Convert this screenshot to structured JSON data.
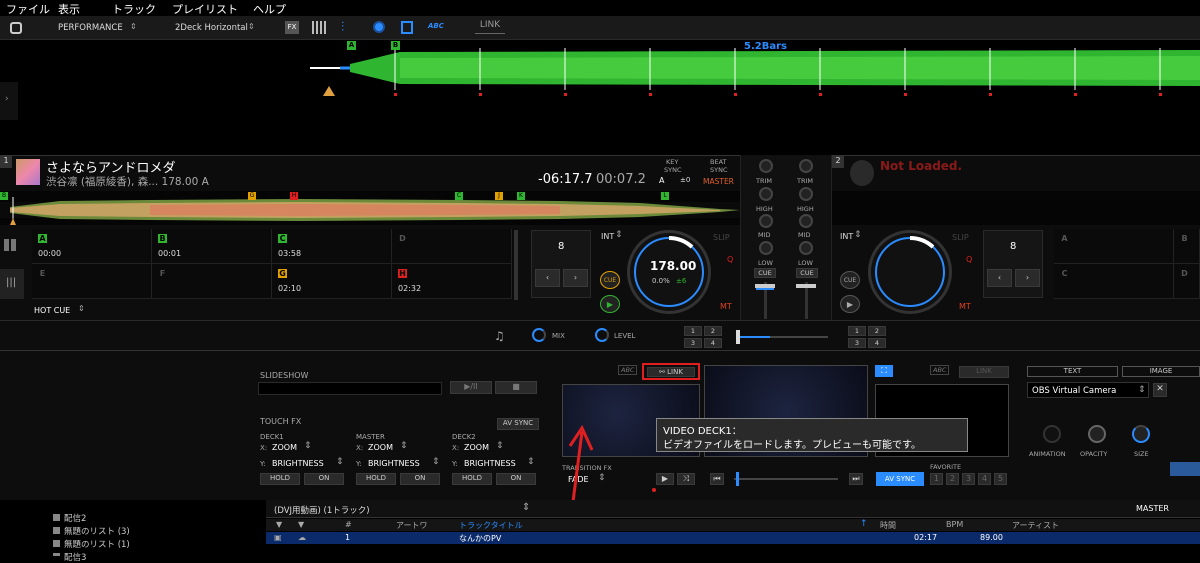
{
  "menu": [
    "ファイル",
    "表示",
    "トラック",
    "プレイリスト",
    "ヘルプ"
  ],
  "toolbar": {
    "mode": "PERFORMANCE",
    "layout": "2Deck Horizontal",
    "fx": "FX",
    "abc": "ABC",
    "link": "LINK"
  },
  "waveform": {
    "bars": "5.2Bars",
    "cue_a": "A",
    "cue_b": "B"
  },
  "deck1": {
    "num": "1",
    "title": "さよならアンドロメダ",
    "artist": "渋谷凛 (福原綾香), 森... 178.00 A",
    "remain": "-06:17.7",
    "elapsed": "00:07.2",
    "key_sync": "KEY\nSYNC",
    "key_label": "KEY",
    "sync_label": "SYNC",
    "key_val": "A",
    "key_off": "±0",
    "beat": "BEAT",
    "beat_sync": "SYNC",
    "master": "MASTER",
    "bpm": "178.00",
    "pct": "0.0%",
    "range": "±6",
    "int": "INT",
    "slip": "SLIP",
    "q": "Q",
    "mt": "MT",
    "cue": "CUE",
    "beatjump": "8",
    "hotcue_label": "HOT CUE"
  },
  "hotcues": [
    {
      "letter": "A",
      "time": "00:00",
      "color": "#2fb52f"
    },
    {
      "letter": "B",
      "time": "00:01",
      "color": "#2fb52f"
    },
    {
      "letter": "C",
      "time": "03:58",
      "color": "#2fb52f"
    },
    {
      "letter": "D",
      "time": "",
      "color": ""
    },
    {
      "letter": "E",
      "time": "",
      "color": ""
    },
    {
      "letter": "F",
      "time": "",
      "color": ""
    },
    {
      "letter": "G",
      "time": "02:10",
      "color": "#e0a000"
    },
    {
      "letter": "H",
      "time": "02:32",
      "color": "#e02020"
    }
  ],
  "deck2": {
    "num": "2",
    "status": "Not Loaded.",
    "int": "INT",
    "slip": "SLIP",
    "q": "Q",
    "mt": "MT",
    "cue": "CUE",
    "beatjump": "8",
    "letters": [
      "A",
      "B",
      "C",
      "D"
    ]
  },
  "mixer": {
    "trim": "TRIM",
    "high": "HIGH",
    "mid": "MID",
    "low": "LOW",
    "cue": "CUE",
    "mix": "MIX",
    "level": "LEVEL"
  },
  "fxnums": [
    "1",
    "2",
    "3",
    "4"
  ],
  "slideshow": {
    "title": "SLIDESHOW",
    "touch_fx": "TOUCH FX",
    "av_sync": "AV SYNC",
    "deck1": "DECK1",
    "master": "MASTER",
    "deck2": "DECK2",
    "x": "X:",
    "y": "Y:",
    "zoom": "ZOOM",
    "brightness": "BRIGHTNESS",
    "hold": "HOLD",
    "on": "ON",
    "play_pause": "▶/II",
    "stop": "■"
  },
  "video": {
    "abc": "ABC",
    "link": "LINK",
    "tooltip_title": "VIDEO DECK1：",
    "tooltip_body": "ビデオファイルをロードします。プレビューも可能です。",
    "transition": "TRANSITION FX",
    "fade": "FADE",
    "av_sync": "AV SYNC",
    "favorite": "FAVORITE",
    "fav_nums": [
      "1",
      "2",
      "3",
      "4",
      "5"
    ]
  },
  "output": {
    "text": "TEXT",
    "image": "IMAGE",
    "camera": "OBS Virtual Camera",
    "animation": "ANIMATION",
    "opacity": "OPACITY",
    "size": "SIZE"
  },
  "browser": {
    "playlist": "(DVJ用動画) (1トラック)",
    "master": "MASTER",
    "tree": [
      "配信2",
      "無題のリスト (3)",
      "無題のリスト (1)",
      "配信3"
    ],
    "columns": {
      "num": "#",
      "art": "アートワ",
      "title": "トラックタイトル",
      "time": "時間",
      "bpm": "BPM",
      "artist": "アーティスト"
    },
    "row": {
      "num": "1",
      "title": "なんかのPV",
      "time": "02:17",
      "bpm": "89.00"
    }
  },
  "colors": {
    "waveform": "#33cc33",
    "accent": "#2a8cff",
    "highlight": "#e02020"
  }
}
